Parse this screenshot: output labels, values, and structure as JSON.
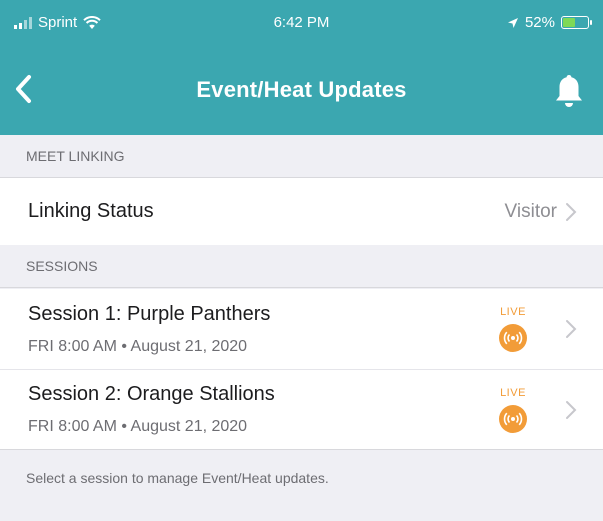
{
  "status_bar": {
    "carrier": "Sprint",
    "time": "6:42 PM",
    "battery": "52%",
    "battery_level": 0.52
  },
  "nav": {
    "title": "Event/Heat Updates",
    "back_icon": "chevron-left-icon",
    "bell_icon": "bell-icon"
  },
  "meet_linking": {
    "header": "MEET LINKING",
    "row_label": "Linking Status",
    "row_value": "Visitor"
  },
  "sessions": {
    "header": "SESSIONS",
    "items": [
      {
        "name": "Session 1: Purple Panthers",
        "meta": "FRI 8:00 AM • August 21, 2020",
        "badge": "LIVE"
      },
      {
        "name": "Session 2: Orange Stallions",
        "meta": "FRI 8:00 AM • August 21, 2020",
        "badge": "LIVE"
      }
    ]
  },
  "footer": {
    "text": "Select a session to manage Event/Heat updates."
  },
  "colors": {
    "brand": "#3ba7b0",
    "live": "#f29c38",
    "battery": "#7ed957"
  }
}
